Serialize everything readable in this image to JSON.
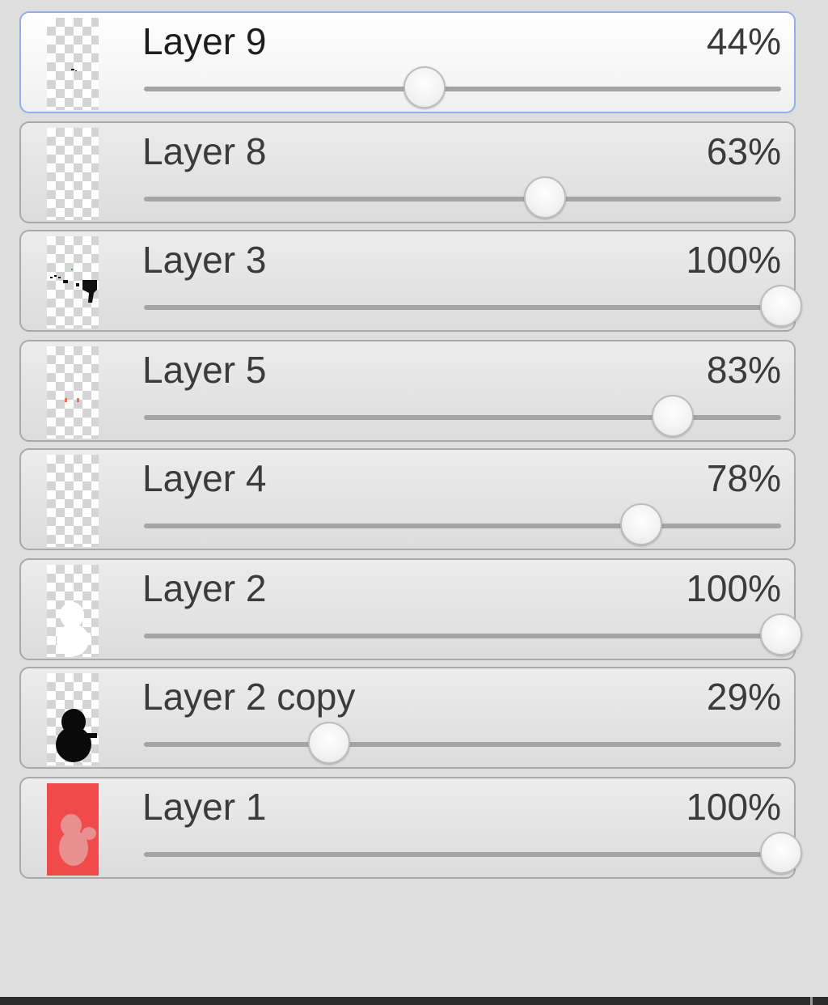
{
  "layers_panel": {
    "layers": [
      {
        "name": "Layer 9",
        "opacity_label": "44%",
        "opacity": 44,
        "selected": true,
        "thumbnail_icon": "layer-9-thumbnail-icon"
      },
      {
        "name": "Layer 8",
        "opacity_label": "63%",
        "opacity": 63,
        "selected": false,
        "thumbnail_icon": "layer-8-thumbnail-icon"
      },
      {
        "name": "Layer 3",
        "opacity_label": "100%",
        "opacity": 100,
        "selected": false,
        "thumbnail_icon": "layer-3-thumbnail-icon"
      },
      {
        "name": "Layer 5",
        "opacity_label": "83%",
        "opacity": 83,
        "selected": false,
        "thumbnail_icon": "layer-5-thumbnail-icon"
      },
      {
        "name": "Layer 4",
        "opacity_label": "78%",
        "opacity": 78,
        "selected": false,
        "thumbnail_icon": "layer-4-thumbnail-icon"
      },
      {
        "name": "Layer 2",
        "opacity_label": "100%",
        "opacity": 100,
        "selected": false,
        "thumbnail_icon": "layer-2-thumbnail-icon"
      },
      {
        "name": "Layer 2 copy",
        "opacity_label": "29%",
        "opacity": 29,
        "selected": false,
        "thumbnail_icon": "layer-2-copy-thumbnail-icon"
      },
      {
        "name": "Layer 1",
        "opacity_label": "100%",
        "opacity": 100,
        "selected": false,
        "thumbnail_icon": "layer-1-thumbnail-icon"
      }
    ]
  },
  "colors": {
    "selected_border": "#8fb0e6",
    "row_border": "#a9a9a9",
    "layer1_fill": "#f04a4a",
    "slider_track": "#a4a4a4"
  }
}
